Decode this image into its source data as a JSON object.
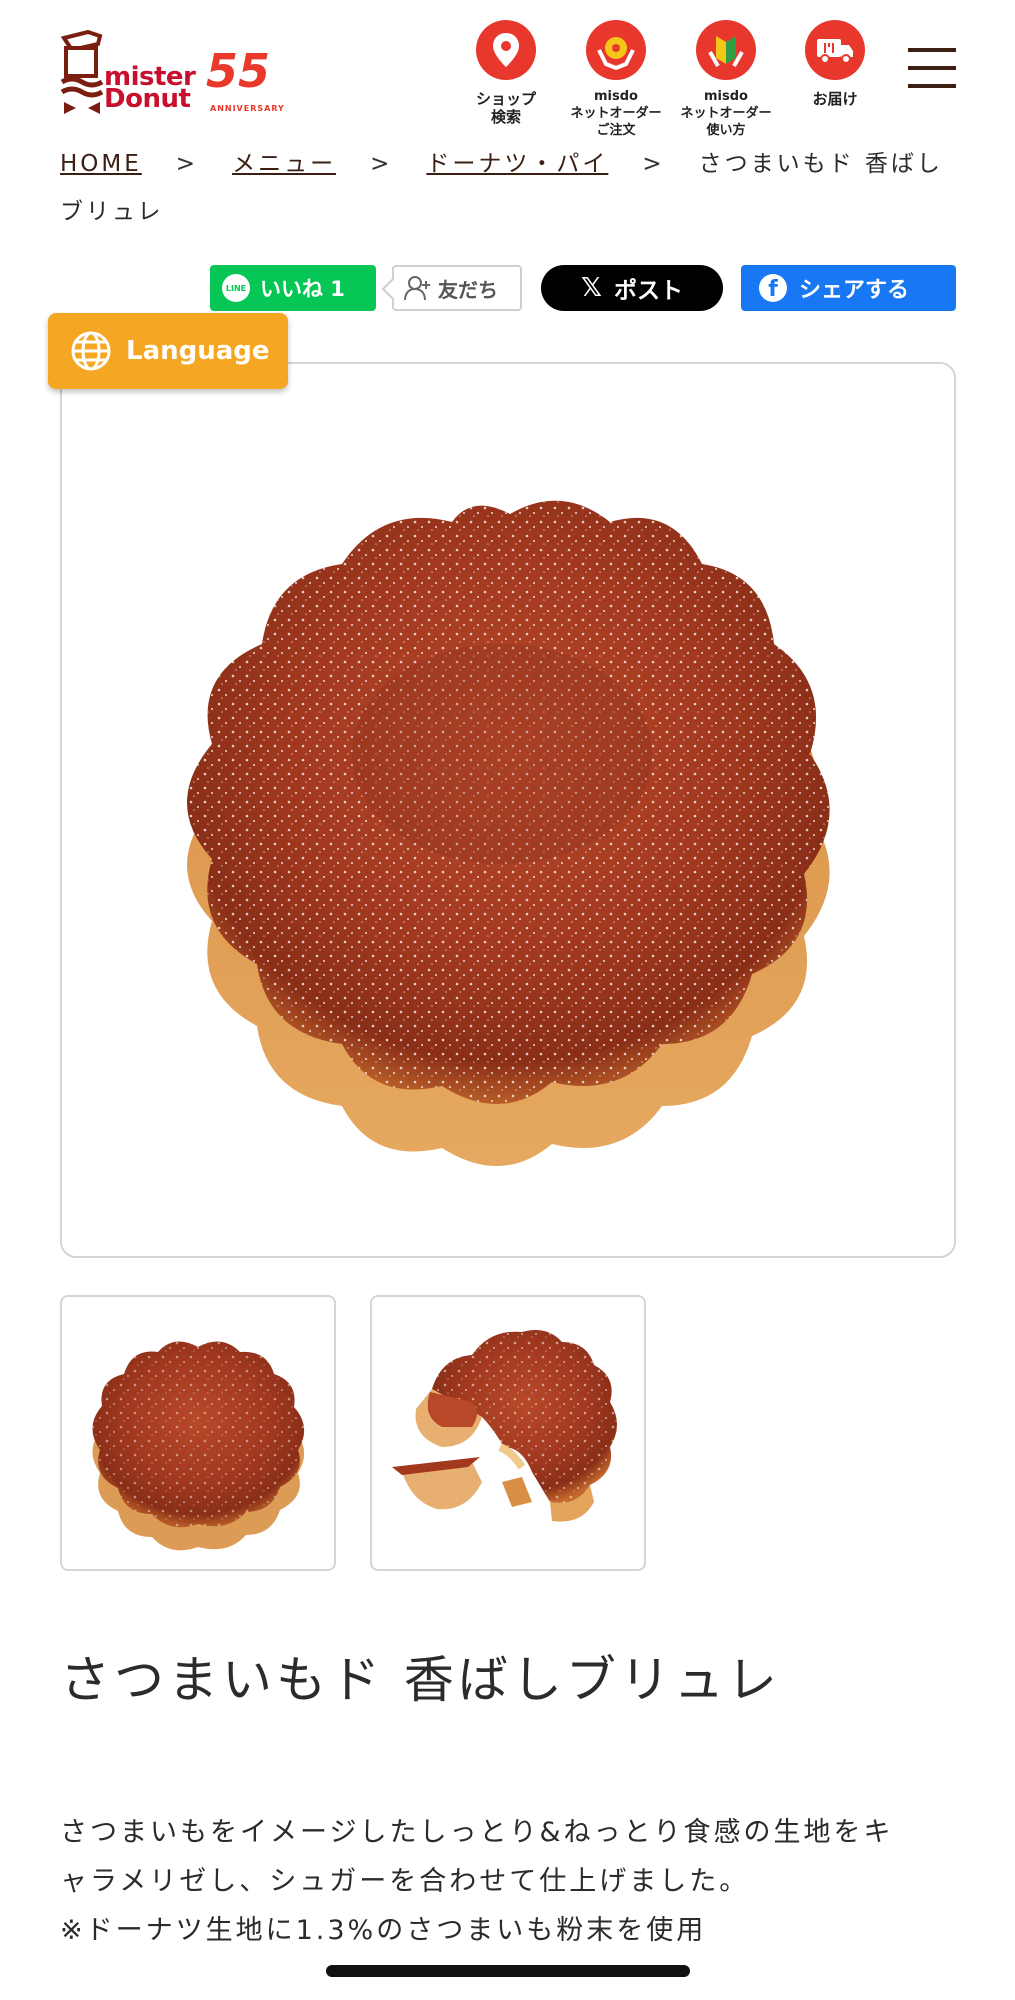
{
  "brand": {
    "logo_text_1": "mister",
    "logo_text_2": "Donut",
    "anniversary_num": "55",
    "anniversary_label": "ANNIVERSARY",
    "accent_color": "#e8382d"
  },
  "nav": [
    {
      "label": "ショップ\n検索",
      "icon": "map-pin-icon"
    },
    {
      "label": "misdo\nネットオーダー\nご注文",
      "icon": "hands-donut-icon"
    },
    {
      "label": "misdo\nネットオーダー\n使い方",
      "icon": "beginner-mark-icon"
    },
    {
      "label": "お届け",
      "icon": "delivery-truck-icon"
    }
  ],
  "breadcrumb": {
    "items": [
      "HOME",
      "メニュー",
      "ドーナツ・パイ"
    ],
    "current": "さつまいもド 香ばしブリュレ",
    "separator": ">"
  },
  "share": {
    "line_badge": "LINE",
    "line_like": "いいね 1",
    "add_friend": "友だち",
    "x_post": "ポスト",
    "facebook_share": "シェアする"
  },
  "language_button": "Language",
  "product": {
    "title": "さつまいもド 香ばしブリュレ",
    "description_lines": [
      "さつまいもをイメージしたしっとり&ねっとり食感の生地をキ",
      "ャラメリゼし、シュガーを合わせて仕上げました。",
      "※ドーナツ生地に1.3%のさつまいも粉末を使用"
    ]
  }
}
